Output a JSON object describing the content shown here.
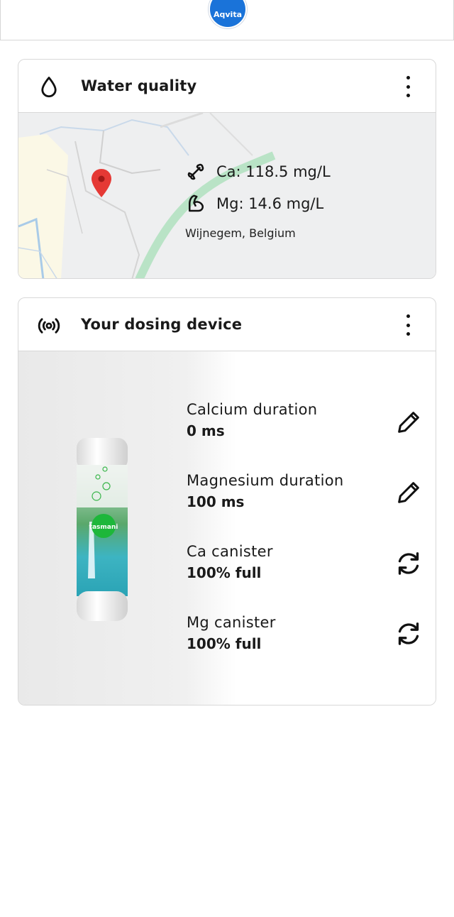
{
  "header": {
    "logo_text": "Aqvita"
  },
  "water_quality": {
    "title": "Water quality",
    "calcium": "Ca: 118.5 mg/L",
    "magnesium": "Mg: 14.6 mg/L",
    "location": "Wijnegem, Belgium"
  },
  "dosing_device": {
    "title": "Your dosing device",
    "product_label": "tasmani",
    "params": [
      {
        "label": "Calcium duration",
        "value": "0 ms",
        "action_icon": "pencil-icon"
      },
      {
        "label": "Magnesium duration",
        "value": "100 ms",
        "action_icon": "pencil-icon"
      },
      {
        "label": "Ca canister",
        "value": "100% full",
        "action_icon": "refresh-icon"
      },
      {
        "label": "Mg canister",
        "value": "100% full",
        "action_icon": "refresh-icon"
      }
    ]
  },
  "colors": {
    "brand": "#1a73d9",
    "map_pin": "#e53935",
    "map_road": "#b9e3c6"
  }
}
